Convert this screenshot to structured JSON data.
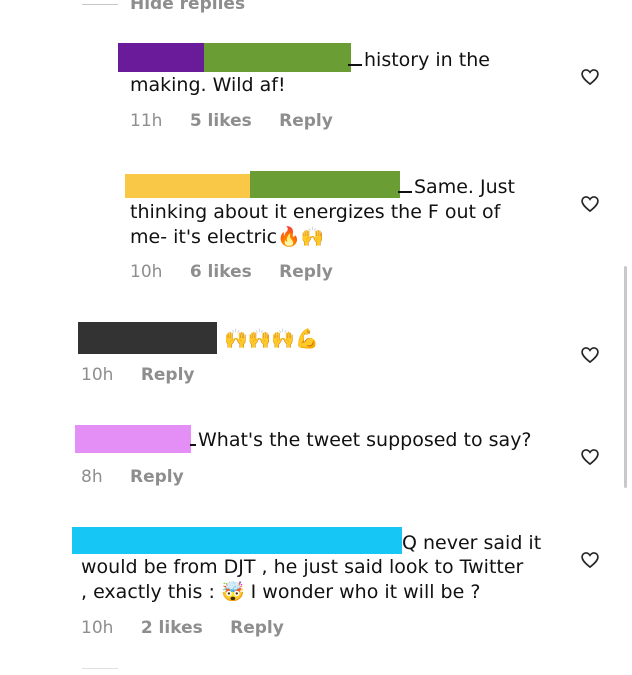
{
  "hide_replies": "Hide replies",
  "comments": [
    {
      "id": "c1",
      "redactions": [
        "#6a1b9a",
        "#6a9e35"
      ],
      "line1": "history in the",
      "line2": "making. Wild af!",
      "time": "11h",
      "likes": "5 likes",
      "reply": "Reply"
    },
    {
      "id": "c2",
      "redactions": [
        "#f8c846",
        "#6a9e35"
      ],
      "line1": "Same. Just",
      "line2": "thinking about it energizes the F out of",
      "line3": "me- it's electric",
      "emojis": "🔥🙌",
      "time": "10h",
      "likes": "6 likes",
      "reply": "Reply"
    },
    {
      "id": "c3",
      "redactions": [
        "#333333"
      ],
      "emojis": "🙌🙌🙌💪",
      "time": "10h",
      "reply": "Reply"
    },
    {
      "id": "c4",
      "redactions": [
        "#e48ff6"
      ],
      "line1": "What's the tweet supposed to say?",
      "time": "8h",
      "reply": "Reply"
    },
    {
      "id": "c5",
      "redactions": [
        "#16c7f5"
      ],
      "line1": "Q never said it",
      "line2": "would be from DJT , he just said look to Twitter",
      "line3a": ", exactly this :",
      "emoji": "🤯",
      "line3b": "I wonder who it will be ?",
      "time": "10h",
      "likes": "2 likes",
      "reply": "Reply"
    }
  ],
  "colors": {
    "meta": "#8e8e8e",
    "text": "#111111",
    "heart": "#262626"
  },
  "icons": {
    "like": "heart-outline-icon"
  }
}
